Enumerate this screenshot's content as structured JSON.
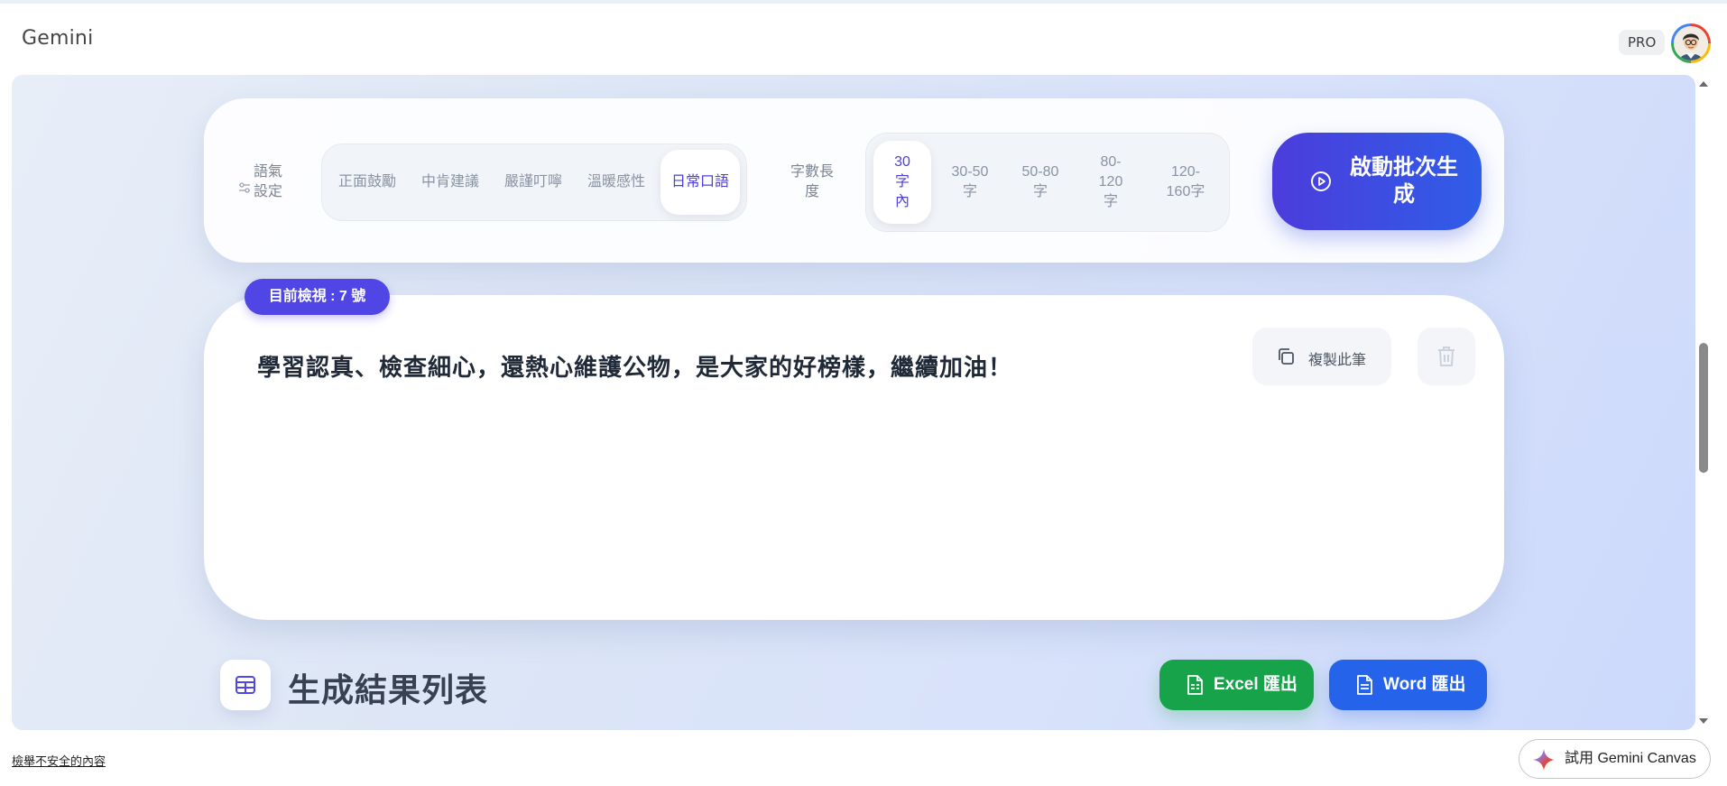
{
  "header": {
    "app_title": "Gemini",
    "plan_badge": "PRO"
  },
  "settings": {
    "tone_label": "語氣設定",
    "tone_options": [
      {
        "label": "正面鼓勵",
        "active": false
      },
      {
        "label": "中肯建議",
        "active": false
      },
      {
        "label": "嚴謹叮嚀",
        "active": false
      },
      {
        "label": "溫暖感性",
        "active": false
      },
      {
        "label": "日常口語",
        "active": true
      }
    ],
    "length_label": "字數長度",
    "length_options": [
      {
        "label": "30字內",
        "active": true
      },
      {
        "label": "30-50字",
        "active": false
      },
      {
        "label": "50-80字",
        "active": false
      },
      {
        "label": "80-120字",
        "active": false
      },
      {
        "label": "120-160字",
        "active": false
      }
    ],
    "start_button_label": "啟動批次生成"
  },
  "result": {
    "viewing_badge": "目前檢視 : 7 號",
    "text": "學習認真、檢查細心，還熱心維護公物，是大家的好榜樣，繼續加油！",
    "copy_label": "複製此筆"
  },
  "results_section": {
    "title": "生成結果列表",
    "excel_label": "Excel 匯出",
    "word_label": "Word 匯出"
  },
  "footer": {
    "report_link": "檢舉不安全的內容",
    "canvas_button": "試用 Gemini Canvas"
  },
  "colors": {
    "accent": "#4f46e5",
    "primary_blue": "#2563eb",
    "excel_green": "#16a34a"
  },
  "icons": {
    "settings": "sliders-icon",
    "start": "play-circle-icon",
    "copy": "copy-icon",
    "delete": "trash-icon",
    "table": "table-icon",
    "export": "document-icon",
    "canvas": "gemini-spark-icon"
  }
}
